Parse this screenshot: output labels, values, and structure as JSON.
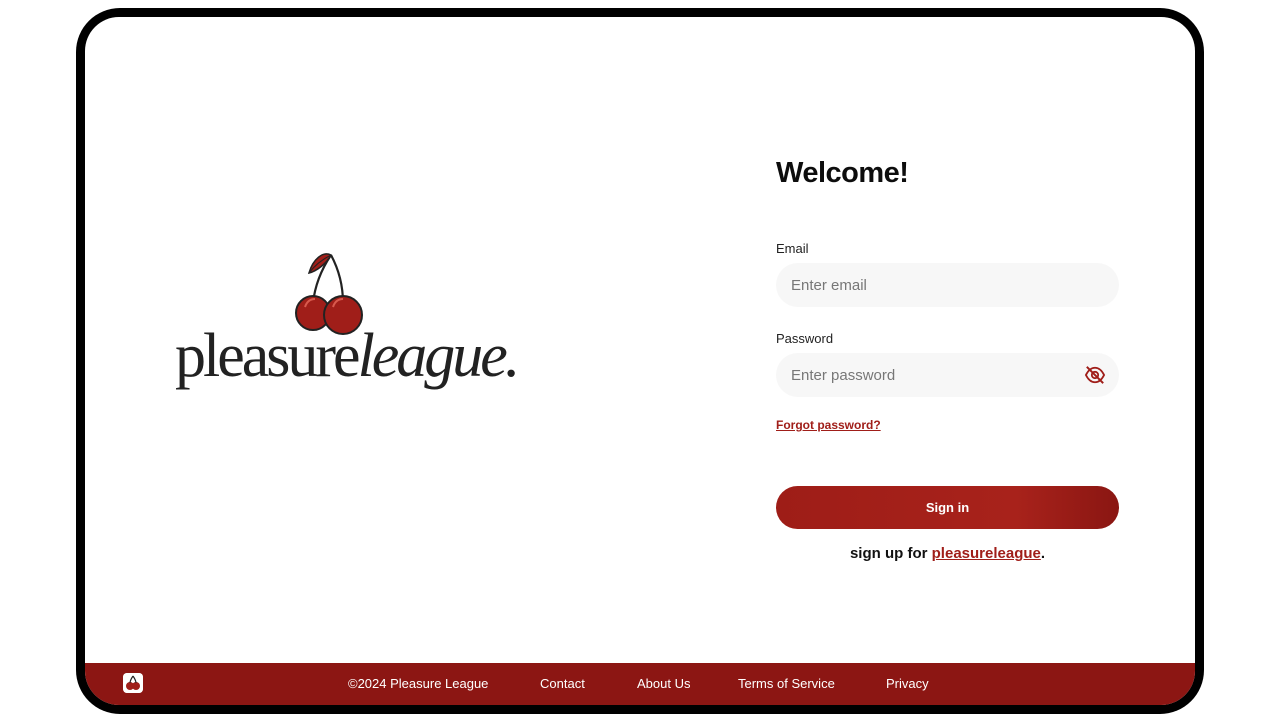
{
  "brand": {
    "logo_word_plain": "pleasure",
    "logo_word_italic": "league.",
    "accent_color": "#a01e19",
    "footer_color": "#8c1613"
  },
  "form": {
    "title": "Welcome!",
    "email_label": "Email",
    "email_placeholder": "Enter email",
    "password_label": "Password",
    "password_placeholder": "Enter password",
    "toggle_icon": "eye-off-icon",
    "forgot_link": "Forgot password?",
    "signin_label": "Sign in",
    "signup_prefix": "sign up for ",
    "signup_link": "pleasureleague",
    "signup_suffix": "."
  },
  "footer": {
    "logo_icon": "cherry-icon",
    "copyright": "©2024 Pleasure League",
    "links": [
      "Contact",
      "About Us",
      "Terms of Service",
      "Privacy"
    ]
  }
}
